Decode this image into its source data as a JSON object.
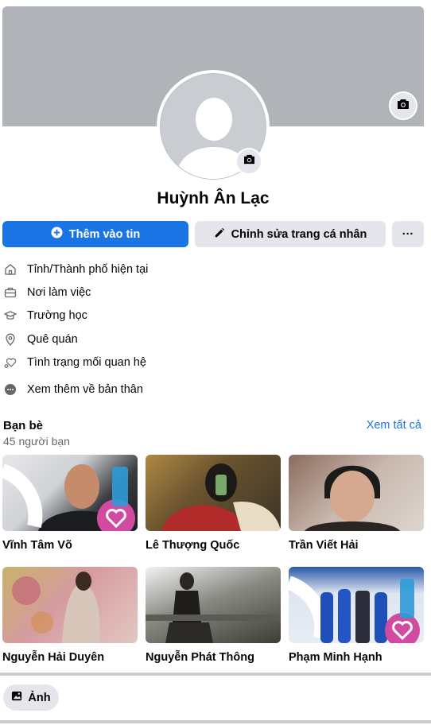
{
  "profile": {
    "name": "Huỳnh Ân Lạc",
    "cover_color": "#b0b3b8",
    "avatar_icon": "default-avatar-silhouette",
    "cover_camera_icon": "camera-icon",
    "avatar_camera_icon": "camera-icon"
  },
  "actions": {
    "add_story_label": "Thêm vào tin",
    "edit_profile_label": "Chỉnh sửa trang cá nhân",
    "more_label": "···"
  },
  "details": [
    {
      "icon": "home-icon",
      "label": "Tỉnh/Thành phố hiện tại"
    },
    {
      "icon": "briefcase-icon",
      "label": "Nơi làm việc"
    },
    {
      "icon": "graduation-cap-icon",
      "label": "Trường học"
    },
    {
      "icon": "location-pin-icon",
      "label": "Quê quán"
    },
    {
      "icon": "hearts-icon",
      "label": "Tình trạng mối quan hệ"
    },
    {
      "icon": "more-dots-icon",
      "label": "Xem thêm về bản thân"
    }
  ],
  "friends": {
    "title": "Bạn bè",
    "count": "45 người bạn",
    "see_all": "Xem tất cả",
    "items": [
      {
        "name": "Vĩnh Tâm Võ"
      },
      {
        "name": "Lê Thượng Quốc"
      },
      {
        "name": "Trần Viết Hải"
      },
      {
        "name": "Nguyễn Hải Duyên"
      },
      {
        "name": "Nguyễn Phát Thông"
      },
      {
        "name": "Phạm Minh Hạnh"
      }
    ]
  },
  "photos": {
    "label": "Ảnh"
  },
  "colors": {
    "accent": "#1b74e4",
    "button_gray": "#e4e6eb",
    "secondary_text": "#65676b"
  }
}
